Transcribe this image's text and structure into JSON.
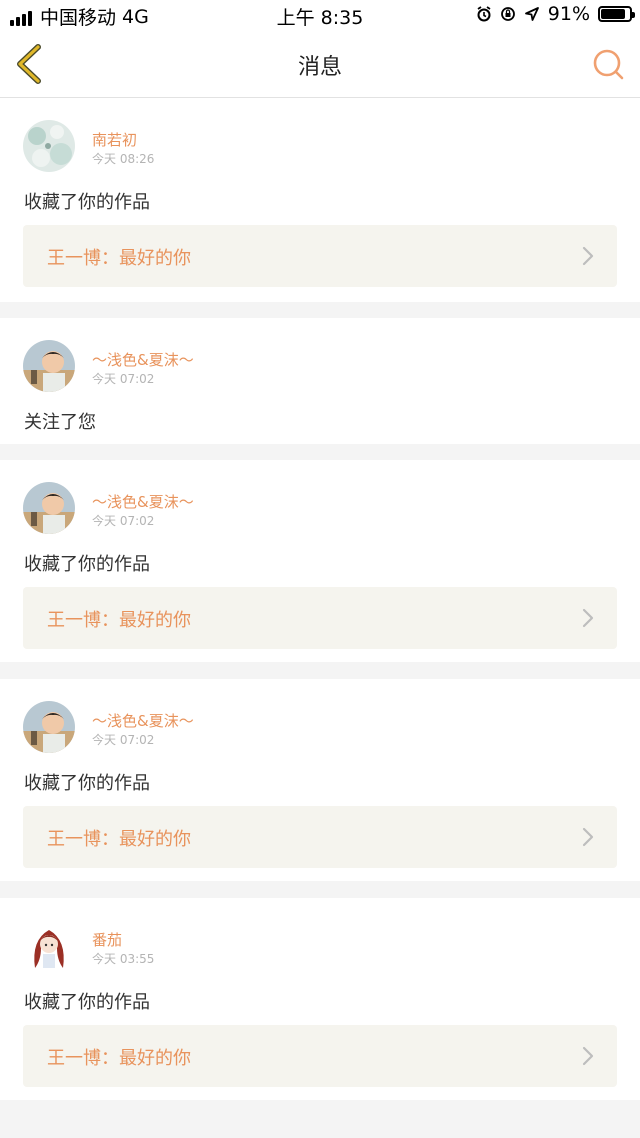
{
  "status_bar": {
    "carrier": "中国移动",
    "network": "4G",
    "time": "上午 8:35",
    "battery_percent": "91%",
    "battery_level": 0.91,
    "icons": [
      "alarm-icon",
      "orientation-lock-icon",
      "location-arrow-icon"
    ]
  },
  "nav": {
    "title": "消息",
    "back_icon": "chevron-left-icon",
    "search_icon": "search-icon",
    "accent_color": "#e8935c",
    "back_color": "#c8a020"
  },
  "messages": [
    {
      "username": "南若初",
      "time": "今天 08:26",
      "action": "收藏了你的作品",
      "work_link": "王一博：最好的你"
    },
    {
      "username": "～浅色&夏沫～",
      "time": "今天 07:02",
      "action": "关注了您",
      "work_link": ""
    },
    {
      "username": "～浅色&夏沫～",
      "time": "今天 07:02",
      "action": "收藏了你的作品",
      "work_link": "王一博：最好的你"
    },
    {
      "username": "～浅色&夏沫～",
      "time": "今天 07:02",
      "action": "收藏了你的作品",
      "work_link": "王一博：最好的你"
    },
    {
      "username": "番茄",
      "time": "今天 03:55",
      "action": "收藏了你的作品",
      "work_link": "王一博：最好的你"
    }
  ]
}
